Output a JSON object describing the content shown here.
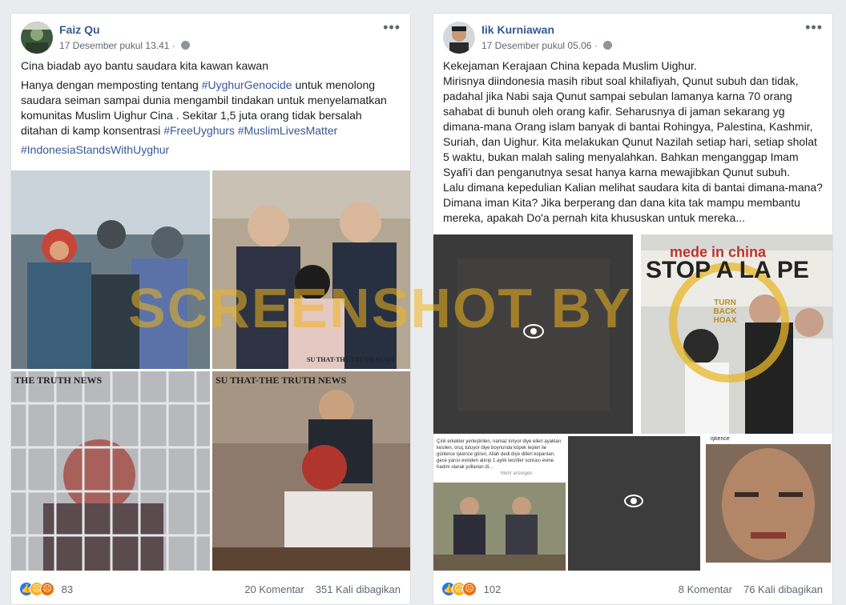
{
  "left_post": {
    "author": "Faiz Qu",
    "timestamp": "17 Desember pukul 13.41",
    "headline": "Cina biadab ayo bantu saudara kita kawan kawan",
    "text_part1": "Hanya dengan memposting tentang ",
    "tag1": "#UyghurGenocide",
    "text_part2": " untuk menolong saudara seiman sampai dunia mengambil tindakan untuk menyelamatkan komunitas Muslim Uighur Cina . Sekitar 1,5 juta orang tidak bersalah ditahan di kamp konsentrasi ",
    "tag2": "#FreeUyghurs",
    "tag3": "#MuslimLivesMatter",
    "tag4": "#IndonesiaStandsWithUyghur",
    "caption_tile2": "SU THAT-THE TRUTH NEWS",
    "caption_tile3": "THE TRUTH NEWS",
    "caption_tile4": "SU THAT-THE TRUTH NEWS",
    "reaction_count": "83",
    "comments": "20 Komentar",
    "shares": "351 Kali dibagikan"
  },
  "right_post": {
    "author": "Iik Kurniawan",
    "timestamp": "17 Desember pukul 05.06",
    "line1": "Kekejaman Kerajaan China kepada Muslim Uighur.",
    "paragraph": "Mirisnya diindonesia masih ribut soal khilafiyah, Qunut subuh dan tidak, padahal jika Nabi saja Qunut sampai sebulan lamanya karna 70 orang sahabat di bunuh oleh orang kafir. Seharusnya di jaman sekarang yg dimana-mana Orang islam banyak di bantai Rohingya, Palestina, Kashmir, Suriah, dan Uighur. Kita melakukan Qunut Nazilah setiap hari, setiap sholat 5 waktu, bukan malah saling menyalahkan. Bahkan menganggap Imam Syafi'i dan penganutnya sesat hanya karna mewajibkan Qunut subuh.",
    "paragraph2": "Lalu dimana kepedulian Kalian melihat saudara kita di bantai dimana-mana? Dimana iman Kita? Jika berperang dan dana kita tak mampu membantu mereka, apakah Do'a pernah kita khususkan untuk mereka...",
    "sign_text": "STOP A LA PE",
    "stamp_top": "mede in china",
    "stamp_mid": "TURN BACK HOAX",
    "tile3_text": "Çinli erkekler yerleştirilen, namaz kılıyor diye elleri ayakları kesilen, oruç tutuyor diye boynunda köpek leşleri ile günlerce işkence gören, Allah dedi diye dilleri koparılan, gece yarısı evinden alınıp 1 aylık tecritler sonrası evine hadım olarak yollanan di...",
    "tile3_more": "Mehr anzeigen",
    "tile5_caption": "işkence",
    "reaction_count": "102",
    "comments": "8 Komentar",
    "shares": "76 Kali dibagikan"
  },
  "watermark": "SCREENSHOT BY",
  "colors": {
    "link": "#365899",
    "bg": "#e9ebee",
    "like": "#2078f4",
    "sad": "#f7b125",
    "angry": "#e9710f"
  }
}
